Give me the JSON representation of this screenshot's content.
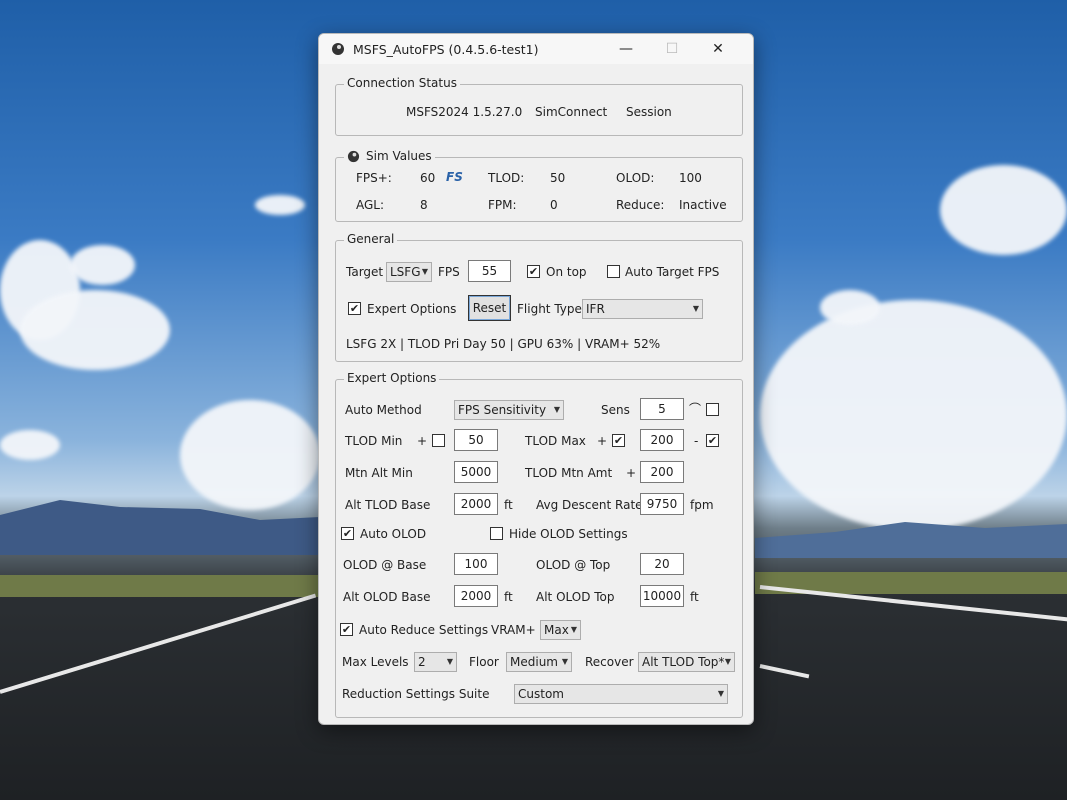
{
  "window": {
    "title": "MSFS_AutoFPS (0.4.5.6-test1)"
  },
  "connection": {
    "label": "Connection Status",
    "sim": "MSFS2024 1.5.27.0",
    "simconnect": "SimConnect",
    "session": "Session"
  },
  "sim_values": {
    "label": "Sim Values",
    "fps_label": "FPS+:",
    "fps_value": "60",
    "fps_mark": "FS",
    "tlod_label": "TLOD:",
    "tlod_value": "50",
    "olod_label": "OLOD:",
    "olod_value": "100",
    "agl_label": "AGL:",
    "agl_value": "8",
    "fpm_label": "FPM:",
    "fpm_value": "0",
    "reduce_label": "Reduce:",
    "reduce_value": "Inactive"
  },
  "general": {
    "label": "General",
    "target_label": "Target",
    "target_value": "LSFG",
    "fps_label": "FPS",
    "fps_value": "55",
    "ontop_label": "On top",
    "ontop_checked": true,
    "auto_target_label": "Auto Target FPS",
    "auto_target_checked": false,
    "expert_label": "Expert Options",
    "expert_checked": true,
    "reset_label": "Reset",
    "flight_type_label": "Flight Type",
    "flight_type_value": "IFR",
    "status_line": "LSFG 2X | TLOD Pri Day 50 | GPU 63% | VRAM+ 52%"
  },
  "expert": {
    "label": "Expert Options",
    "auto_method_label": "Auto Method",
    "auto_method_value": "FPS Sensitivity",
    "sens_label": "Sens",
    "sens_value": "5",
    "sens_symbol": "⌒",
    "tlod_min_label": "TLOD Min",
    "plus": "+",
    "minus": "-",
    "tlod_min_value": "50",
    "tlod_min_checked": false,
    "tlod_max_label": "TLOD Max",
    "tlod_max_value": "200",
    "tlod_max_plus_checked": true,
    "tlod_max_minus_checked": true,
    "mtn_alt_min_label": "Mtn Alt Min",
    "mtn_alt_min_value": "5000",
    "tlod_mtn_amt_label": "TLOD Mtn Amt",
    "tlod_mtn_amt_value": "200",
    "alt_tlod_base_label": "Alt TLOD Base",
    "alt_tlod_base_value": "2000",
    "ft": "ft",
    "avg_descent_label": "Avg Descent Rate",
    "avg_descent_value": "9750",
    "fpm": "fpm",
    "auto_olod_label": "Auto OLOD",
    "auto_olod_checked": true,
    "hide_olod_label": "Hide OLOD Settings",
    "hide_olod_checked": false,
    "olod_base_label": "OLOD @ Base",
    "olod_base_value": "100",
    "olod_top_label": "OLOD @ Top",
    "olod_top_value": "20",
    "alt_olod_base_label": "Alt OLOD Base",
    "alt_olod_base_value": "2000",
    "alt_olod_top_label": "Alt OLOD Top",
    "alt_olod_top_value": "10000",
    "auto_reduce_label": "Auto Reduce Settings",
    "auto_reduce_checked": true,
    "vram_label": "VRAM+",
    "vram_value": "Max",
    "max_levels_label": "Max Levels",
    "max_levels_value": "2",
    "floor_label": "Floor",
    "floor_value": "Medium",
    "recover_label": "Recover",
    "recover_value": "Alt TLOD Top*",
    "suite_label": "Reduction Settings Suite",
    "suite_value": "Custom"
  }
}
